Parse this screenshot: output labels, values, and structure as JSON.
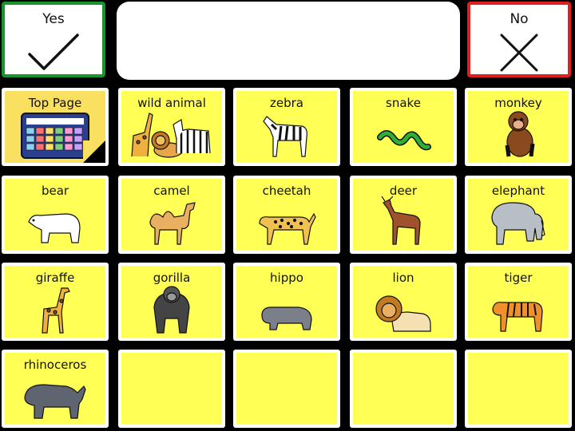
{
  "top_bar": {
    "yes_label": "Yes",
    "no_label": "No",
    "message": ""
  },
  "grid": {
    "cells": [
      {
        "label": "Top Page",
        "icon": "grid-board-icon"
      },
      {
        "label": "wild animal",
        "icon": "wild-animals-icon"
      },
      {
        "label": "zebra",
        "icon": "zebra-icon"
      },
      {
        "label": "snake",
        "icon": "snake-icon"
      },
      {
        "label": "monkey",
        "icon": "monkey-icon"
      },
      {
        "label": "bear",
        "icon": "polar-bear-icon"
      },
      {
        "label": "camel",
        "icon": "camel-icon"
      },
      {
        "label": "cheetah",
        "icon": "cheetah-icon"
      },
      {
        "label": "deer",
        "icon": "deer-icon"
      },
      {
        "label": "elephant",
        "icon": "elephant-icon"
      },
      {
        "label": "giraffe",
        "icon": "giraffe-icon"
      },
      {
        "label": "gorilla",
        "icon": "gorilla-icon"
      },
      {
        "label": "hippo",
        "icon": "hippo-icon"
      },
      {
        "label": "lion",
        "icon": "lion-icon"
      },
      {
        "label": "tiger",
        "icon": "tiger-icon"
      },
      {
        "label": "rhinoceros",
        "icon": "rhinoceros-icon"
      },
      {
        "label": "",
        "icon": ""
      },
      {
        "label": "",
        "icon": ""
      },
      {
        "label": "",
        "icon": ""
      },
      {
        "label": "",
        "icon": ""
      }
    ]
  },
  "colors": {
    "yes_border": "#18932e",
    "no_border": "#e02020",
    "cell_fill": "#ffff55",
    "top_page_fill": "#f9e060",
    "background": "#000000"
  }
}
